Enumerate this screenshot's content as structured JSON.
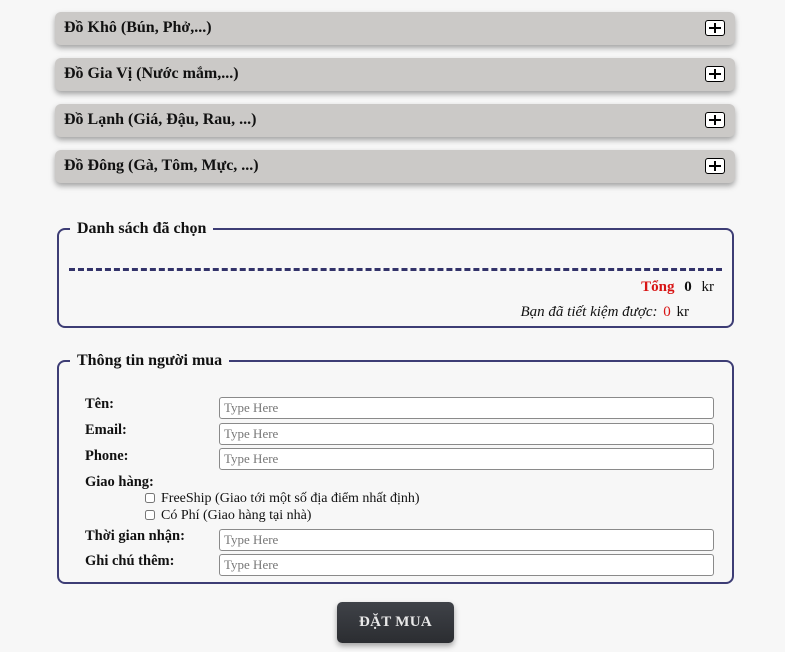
{
  "categories": [
    {
      "label": "Đồ Khô (Bún, Phở,...)"
    },
    {
      "label": "Đồ Gia Vị (Nước mắm,...)"
    },
    {
      "label": "Đồ Lạnh (Giá, Đậu, Rau, ...)"
    },
    {
      "label": "Đồ Đông (Gà, Tôm, Mực, ...)"
    }
  ],
  "selected": {
    "title": "Danh sách đã chọn",
    "total_label": "Tổng",
    "total_value": "0",
    "total_unit": "kr",
    "saving_label": "Bạn đã tiết kiệm được:",
    "saving_value": "0",
    "saving_unit": "kr"
  },
  "buyer": {
    "title": "Thông tin người mua",
    "name_label": "Tên:",
    "name_placeholder": "Type Here",
    "email_label": "Email:",
    "email_placeholder": "Type Here",
    "phone_label": "Phone:",
    "phone_placeholder": "Type Here",
    "delivery_label": "Giao hàng:",
    "delivery_options": [
      {
        "label": "FreeShip (Giao tới một số địa điểm nhất định)"
      },
      {
        "label": "Có Phí (Giao hàng tại nhà)"
      }
    ],
    "time_label": "Thời gian nhận:",
    "time_placeholder": "Type Here",
    "note_label": "Ghi chú thêm:",
    "note_placeholder": "Type Here"
  },
  "order_button": "ĐẶT MUA",
  "colors": {
    "accent_red": "#d81515",
    "border_navy": "#3d3d75",
    "category_bg": "#cbc9c7",
    "button_bg": "#35373c"
  }
}
